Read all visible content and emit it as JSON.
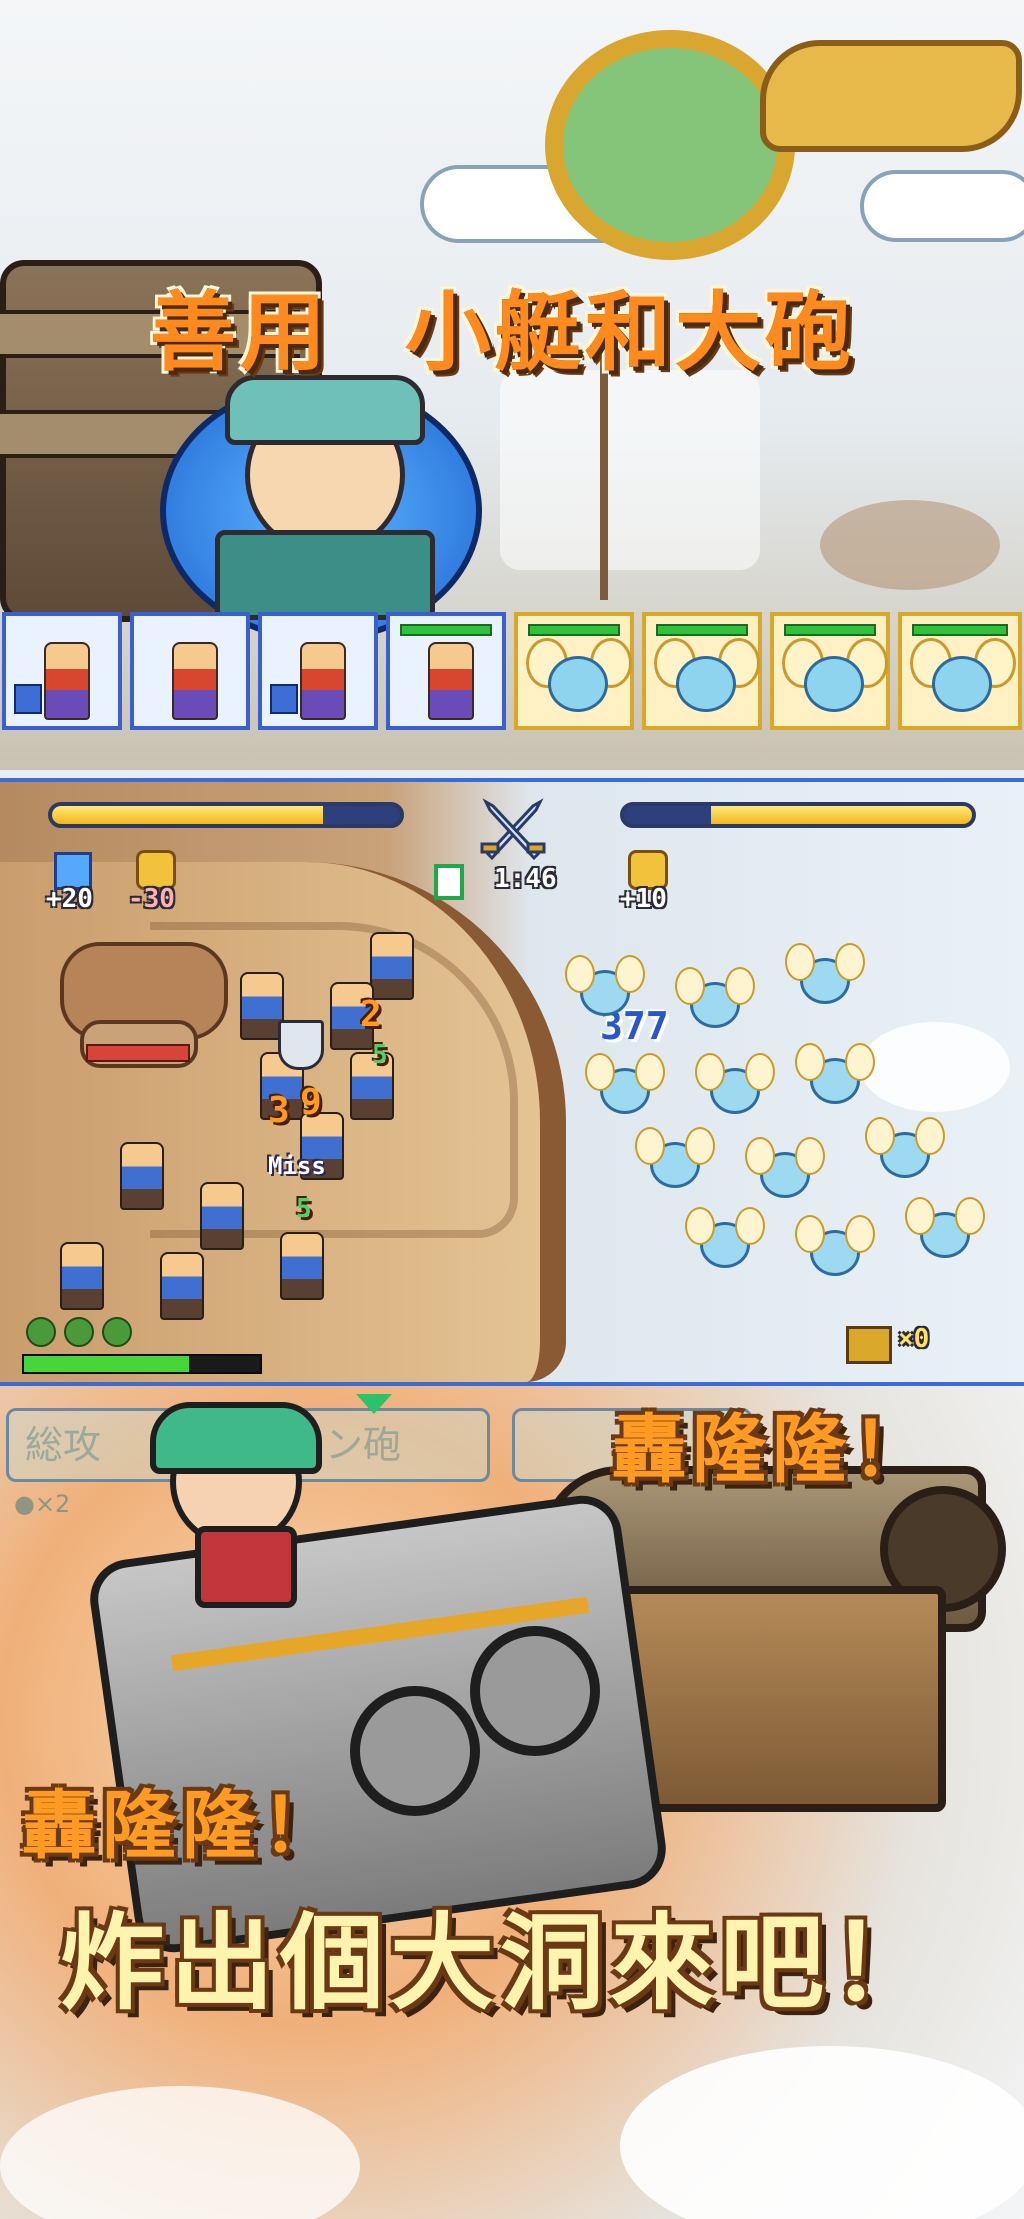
{
  "top_panel": {
    "title_left": "善用",
    "title_right": "小艇和大砲"
  },
  "battle": {
    "timer": "1:46",
    "player_stats": {
      "defense": "+20",
      "attack": "-30"
    },
    "enemy_stat": "+10",
    "damage_numbers": [
      "2",
      "3",
      "9",
      "5",
      "5",
      "377"
    ],
    "miss_label": "Miss",
    "counter_label": "×0",
    "player_hp_fraction": 0.78,
    "enemy_hp_fraction": 0.75,
    "player_gauge_fraction": 0.7
  },
  "bottom_panel": {
    "menu": [
      {
        "label": "総攻",
        "sub": "●×2"
      },
      {
        "label": "ノン砲"
      },
      {
        "label": ""
      }
    ],
    "shout_small": "轟隆隆！",
    "shout_left": "轟隆隆！",
    "headline": "炸出個大洞來吧！"
  },
  "colors": {
    "accent_orange": "#ff8a1e",
    "frame_blue": "#3b6bd6",
    "hp_yellow": "#f2b61c"
  },
  "icons": [
    "sword-cross-icon",
    "hourglass-icon",
    "shield-icon",
    "fist-icon",
    "treasure-icon"
  ]
}
